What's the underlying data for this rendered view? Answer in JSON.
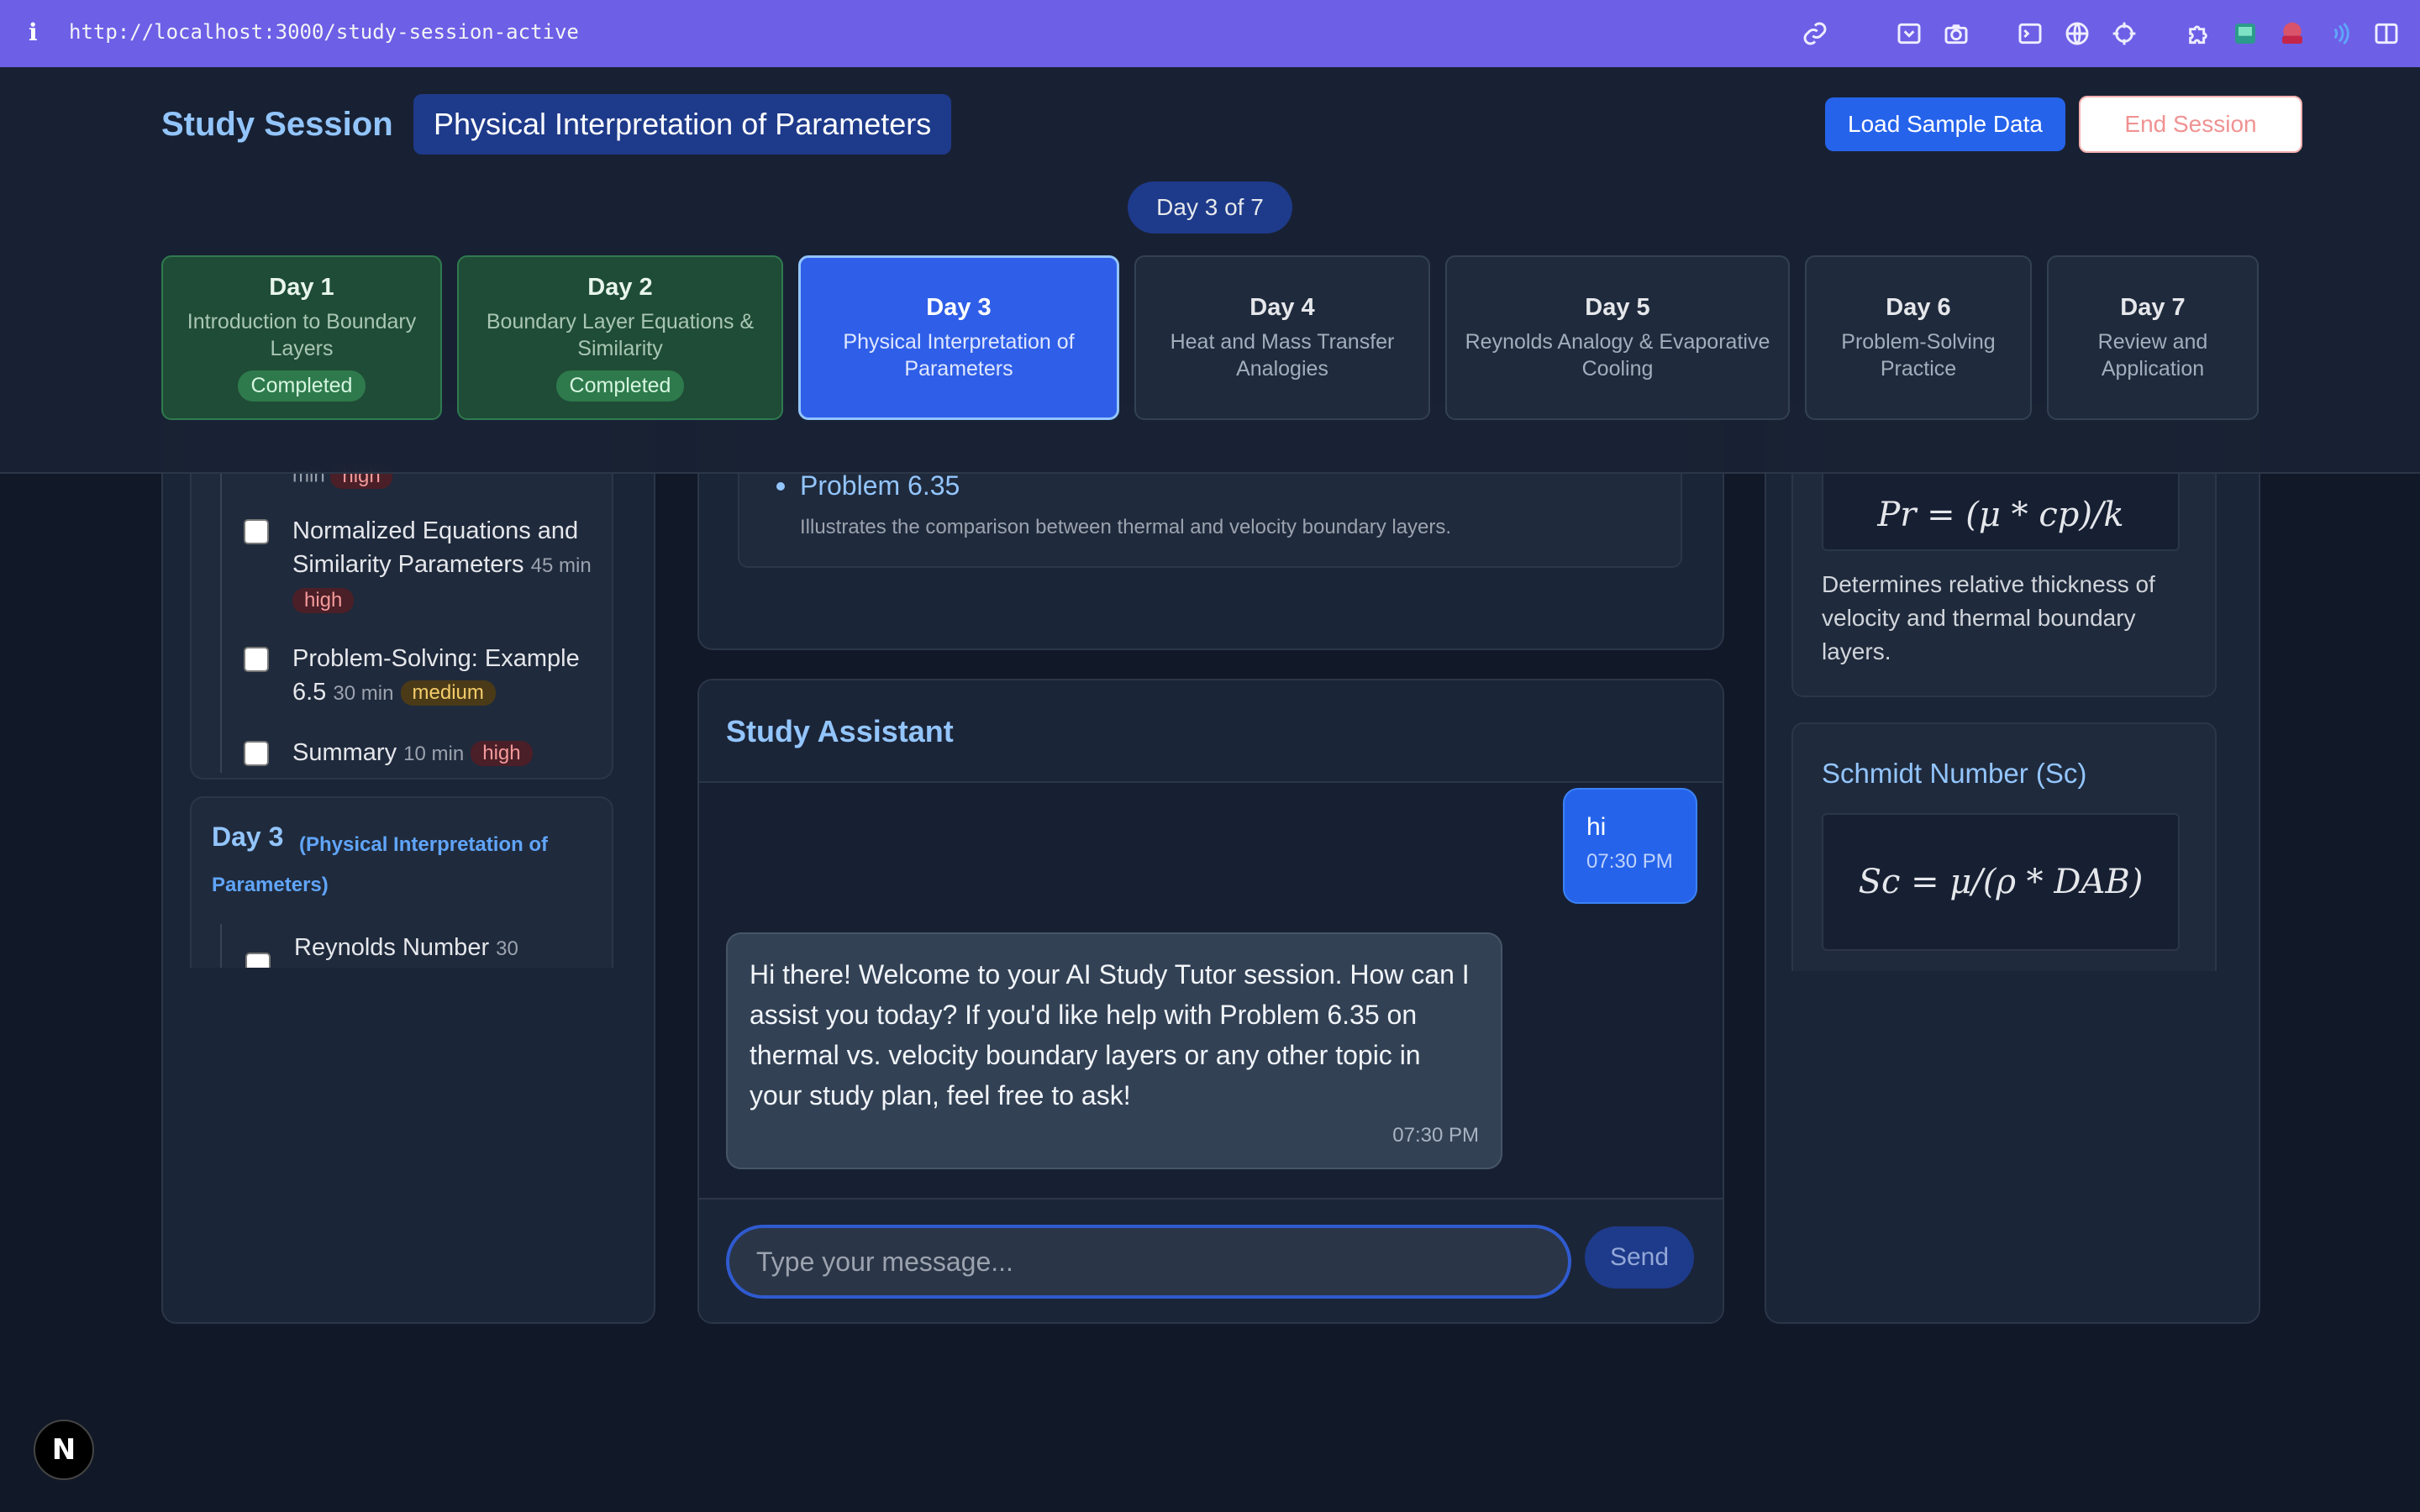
{
  "browser": {
    "url": "http://localhost:3000/study-session-active",
    "icons": [
      "link-icon",
      "screenshot-icon",
      "camera-icon",
      "terminal-icon",
      "globe-icon",
      "crosshair-icon",
      "puzzle-icon",
      "extension-icon",
      "extension-new-icon",
      "wave-icon",
      "sidebar-icon"
    ]
  },
  "header": {
    "title": "Study Session",
    "topic": "Physical Interpretation of Parameters",
    "load_button": "Load Sample Data",
    "end_button": "End Session",
    "day_counter": "Day 3 of 7"
  },
  "days": [
    {
      "name": "Day 1",
      "topic": "Introduction to Boundary Layers",
      "status": "Completed"
    },
    {
      "name": "Day 2",
      "topic": "Boundary Layer Equations & Similarity",
      "status": "Completed"
    },
    {
      "name": "Day 3",
      "topic": "Physical Interpretation of Parameters",
      "status": ""
    },
    {
      "name": "Day 4",
      "topic": "Heat and Mass Transfer Analogies",
      "status": ""
    },
    {
      "name": "Day 5",
      "topic": "Reynolds Analogy & Evaporative Cooling",
      "status": ""
    },
    {
      "name": "Day 6",
      "topic": "Problem-Solving Practice",
      "status": ""
    },
    {
      "name": "Day 7",
      "topic": "Review and Application",
      "status": ""
    }
  ],
  "plan": {
    "cut_task": {
      "duration": "min",
      "priority": "high"
    },
    "tasks": [
      {
        "title": "Normalized Equations and Similarity Parameters",
        "duration": "45 min",
        "priority": "high"
      },
      {
        "title": "Problem-Solving: Example 6.5",
        "duration": "30 min",
        "priority": "medium"
      },
      {
        "title": "Summary",
        "duration": "10 min",
        "priority": "high"
      }
    ],
    "day3": {
      "title": "Day 3",
      "subtitle": "(Physical Interpretation of Parameters)",
      "first_task": {
        "title": "Reynolds Number",
        "duration": "30"
      }
    }
  },
  "problem": {
    "title": "Problem 6.35",
    "description": "Illustrates the comparison between thermal and velocity boundary layers."
  },
  "chat": {
    "title": "Study Assistant",
    "messages": [
      {
        "role": "user",
        "text": "hi",
        "time": "07:30 PM"
      },
      {
        "role": "assistant",
        "text": "Hi there! Welcome to your AI Study Tutor session. How can I assist you today? If you'd like help with Problem 6.35 on thermal vs. velocity boundary layers or any other topic in your study plan, feel free to ask!",
        "time": "07:30 PM"
      }
    ],
    "input_placeholder": "Type your message...",
    "send_label": "Send"
  },
  "formulas": {
    "prandtl": {
      "formula": "Pr = (μ * cp)/k",
      "description": "Determines relative thickness of velocity and thermal boundary layers."
    },
    "schmidt": {
      "title": "Schmidt Number (Sc)",
      "formula": "Sc = μ/(ρ * DAB)"
    }
  }
}
